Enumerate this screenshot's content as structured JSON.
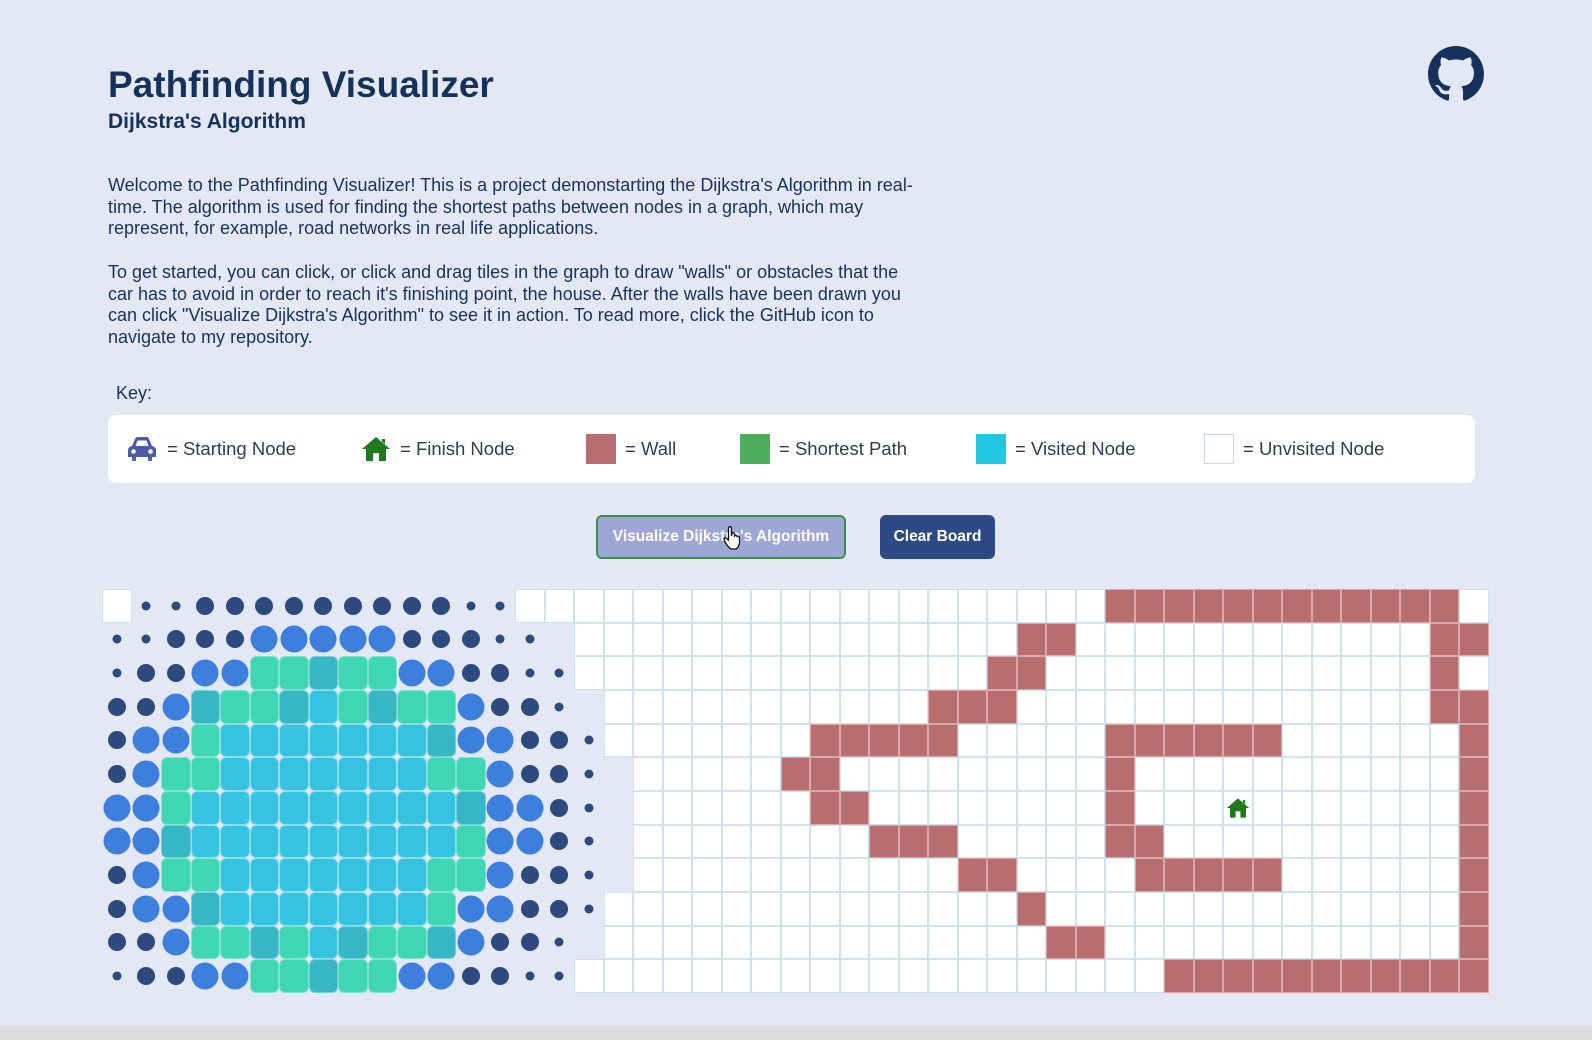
{
  "header": {
    "title": "Pathfinding Visualizer",
    "subtitle": "Dijkstra's Algorithm"
  },
  "intro": {
    "paragraph1": "Welcome to the Pathfinding Visualizer! This is a project demonstarting the Dijkstra's Algorithm in real-time. The algorithm is used for finding the shortest paths between nodes in a graph, which may represent, for example, road networks in real life applications.",
    "paragraph2": "To get started, you can click, or click and drag tiles in the graph to draw \"walls\" or obstacles that the car has to avoid in order to reach it's finishing point, the house. After the walls have been drawn you can click \"Visualize Dijkstra's Algorithm\" to see it in action. To read more, click the GitHub icon to navigate to my repository."
  },
  "key": {
    "label": "Key:",
    "items": [
      {
        "icon": "car-icon",
        "label": "= Starting Node"
      },
      {
        "icon": "house-icon",
        "label": "= Finish Node"
      },
      {
        "icon": "wall-swatch",
        "label": "= Wall"
      },
      {
        "icon": "shortest-path-swatch",
        "label": "= Shortest Path"
      },
      {
        "icon": "visited-swatch",
        "label": "= Visited Node"
      },
      {
        "icon": "unvisited-swatch",
        "label": "= Unvisited Node"
      }
    ]
  },
  "controls": {
    "visualize_label": "Visualize Dijkstra's Algorithm",
    "clear_label": "Clear Board"
  },
  "grid": {
    "rows": 12,
    "cols": 47,
    "finish": {
      "row": 6,
      "col": 38
    },
    "walls": [
      [
        0,
        34
      ],
      [
        0,
        35
      ],
      [
        0,
        36
      ],
      [
        0,
        37
      ],
      [
        0,
        38
      ],
      [
        0,
        39
      ],
      [
        0,
        40
      ],
      [
        0,
        41
      ],
      [
        0,
        42
      ],
      [
        0,
        43
      ],
      [
        0,
        44
      ],
      [
        0,
        45
      ],
      [
        1,
        31
      ],
      [
        1,
        32
      ],
      [
        1,
        45
      ],
      [
        1,
        46
      ],
      [
        2,
        30
      ],
      [
        2,
        31
      ],
      [
        2,
        45
      ],
      [
        3,
        28
      ],
      [
        3,
        29
      ],
      [
        3,
        30
      ],
      [
        3,
        45
      ],
      [
        3,
        46
      ],
      [
        4,
        24
      ],
      [
        4,
        25
      ],
      [
        4,
        26
      ],
      [
        4,
        27
      ],
      [
        4,
        28
      ],
      [
        4,
        34
      ],
      [
        4,
        35
      ],
      [
        4,
        36
      ],
      [
        4,
        37
      ],
      [
        4,
        38
      ],
      [
        4,
        39
      ],
      [
        4,
        46
      ],
      [
        5,
        23
      ],
      [
        5,
        24
      ],
      [
        5,
        34
      ],
      [
        5,
        46
      ],
      [
        6,
        24
      ],
      [
        6,
        25
      ],
      [
        6,
        34
      ],
      [
        6,
        46
      ],
      [
        7,
        26
      ],
      [
        7,
        27
      ],
      [
        7,
        28
      ],
      [
        7,
        34
      ],
      [
        7,
        35
      ],
      [
        7,
        46
      ],
      [
        8,
        29
      ],
      [
        8,
        30
      ],
      [
        8,
        35
      ],
      [
        8,
        36
      ],
      [
        8,
        37
      ],
      [
        8,
        38
      ],
      [
        8,
        39
      ],
      [
        8,
        46
      ],
      [
        9,
        31
      ],
      [
        9,
        46
      ],
      [
        10,
        32
      ],
      [
        10,
        33
      ],
      [
        10,
        46
      ],
      [
        11,
        36
      ],
      [
        11,
        37
      ],
      [
        11,
        38
      ],
      [
        11,
        39
      ],
      [
        11,
        40
      ],
      [
        11,
        41
      ],
      [
        11,
        42
      ],
      [
        11,
        43
      ],
      [
        11,
        44
      ],
      [
        11,
        45
      ],
      [
        11,
        46
      ]
    ],
    "colors": {
      "wall": "#b86e6e",
      "shortest_path": "#4fae5e",
      "visited": "#20c7e0",
      "unvisited": "#ffffff",
      "finish_icon": "#1f7a1f",
      "car_icon": "#4a5aa8",
      "ring_dark": "#2c4a7e",
      "ring_blue": "#3d7fdc"
    }
  }
}
